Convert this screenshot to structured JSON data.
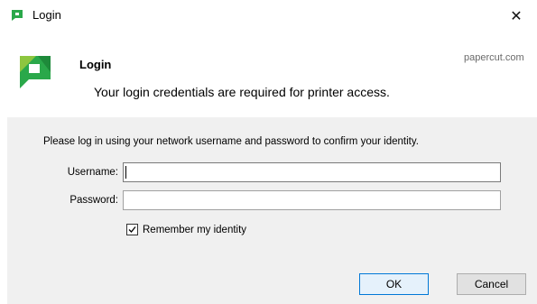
{
  "window": {
    "title": "Login",
    "close_glyph": "✕"
  },
  "header": {
    "brand_url": "papercut.com",
    "heading": "Login",
    "subheading": "Your login credentials are required for printer access."
  },
  "form": {
    "instructions": "Please log in using your network username and password to confirm your identity.",
    "username_label": "Username:",
    "username_value": "",
    "password_label": "Password:",
    "password_value": "",
    "remember_label": "Remember my identity",
    "remember_checked": true
  },
  "buttons": {
    "ok_label": "OK",
    "cancel_label": "Cancel"
  },
  "icons": {
    "app": "papercut-logo-icon",
    "close": "close-icon",
    "checkbox": "check-icon"
  },
  "colors": {
    "brand_green": "#2aa84a",
    "brand_light_green": "#8dc63f",
    "focus_blue": "#0078d7"
  }
}
